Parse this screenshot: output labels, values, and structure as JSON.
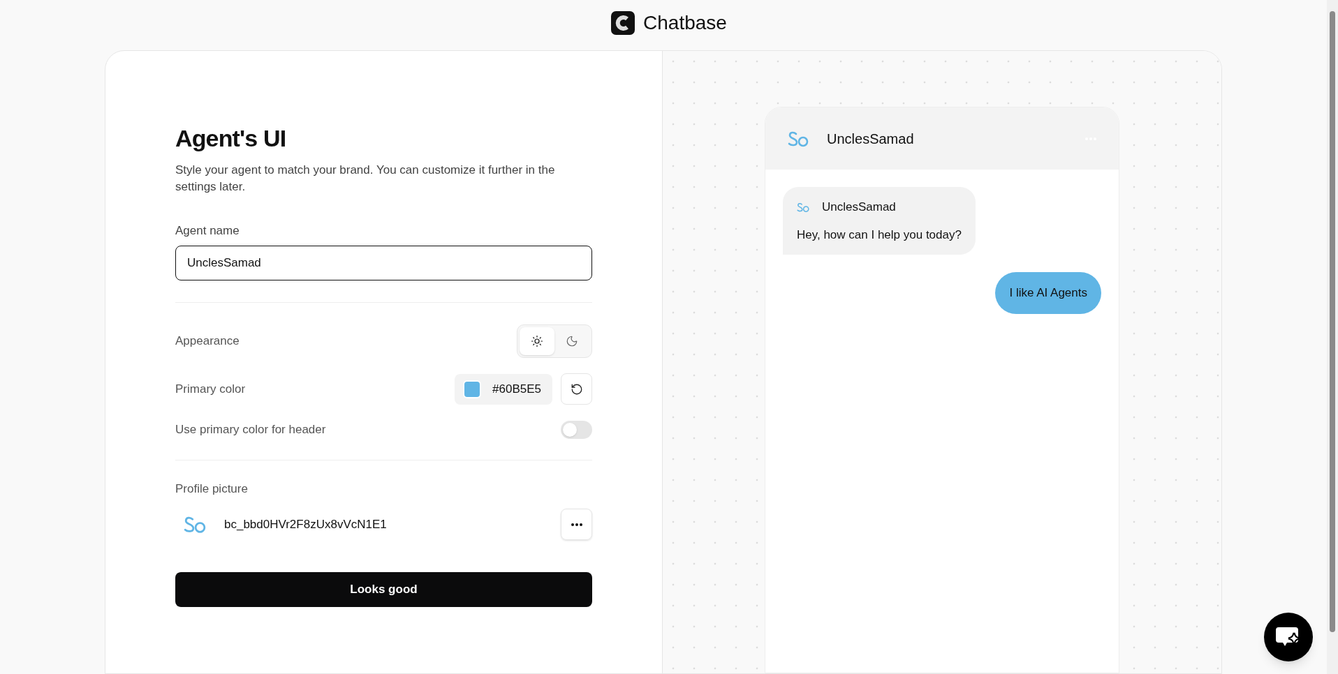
{
  "header": {
    "brand": "Chatbase"
  },
  "form": {
    "title": "Agent's UI",
    "subtitle": "Style your agent to match your brand. You can customize it further in the settings later.",
    "agent_name": {
      "label": "Agent name",
      "value": "UnclesSamad"
    },
    "appearance": {
      "label": "Appearance",
      "options": [
        {
          "kind": "light",
          "selected": true
        },
        {
          "kind": "dark",
          "selected": false
        }
      ]
    },
    "primary_color": {
      "label": "Primary color",
      "value": "#60B5E5"
    },
    "header_color": {
      "label": "Use primary color for header",
      "on": false
    },
    "profile_picture": {
      "label": "Profile picture",
      "file": "bc_bbd0HVr2F8zUx8vVcN1E1"
    },
    "submit": "Looks good"
  },
  "preview": {
    "agent_name": "UnclesSamad",
    "messages": [
      {
        "kind": "agent",
        "sender": "UnclesSamad",
        "text": "Hey, how can I help you today?"
      },
      {
        "kind": "user",
        "text": "I like AI Agents"
      }
    ]
  }
}
